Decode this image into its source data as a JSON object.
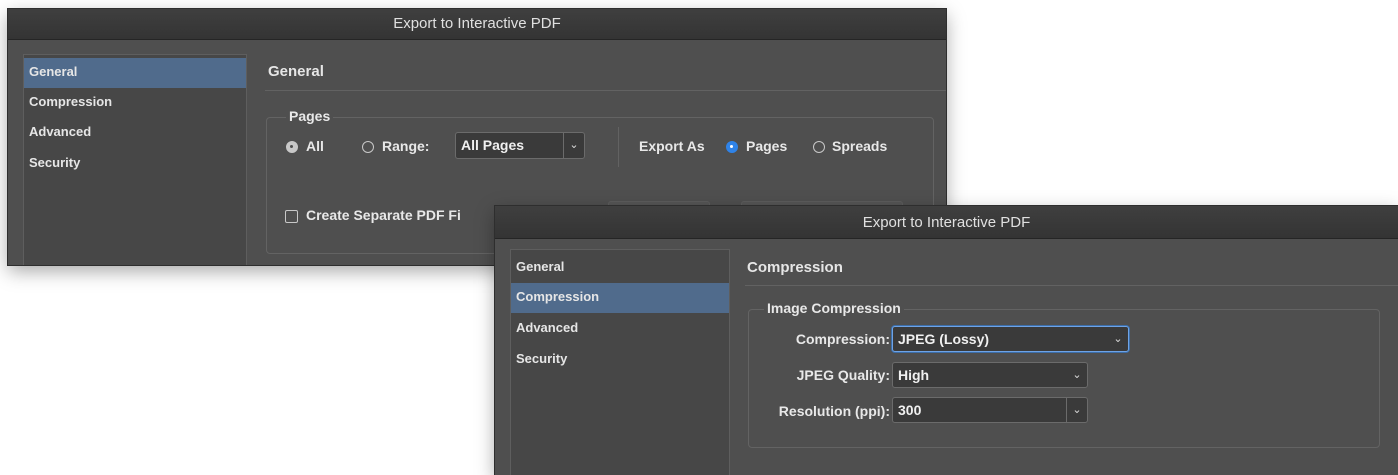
{
  "back_dialog": {
    "title": "Export to Interactive PDF",
    "sidebar": [
      {
        "label": "General",
        "selected": true
      },
      {
        "label": "Compression",
        "selected": false
      },
      {
        "label": "Advanced",
        "selected": false
      },
      {
        "label": "Security",
        "selected": false
      }
    ],
    "section_title": "General",
    "pages": {
      "group_title": "Pages",
      "all_label": "All",
      "all_selected": true,
      "range_label": "Range:",
      "range_value": "All Pages",
      "export_as_label": "Export As",
      "pages_label": "Pages",
      "pages_selected": true,
      "spreads_label": "Spreads",
      "create_separate_label": "Create Separate PDF Fi",
      "create_separate_checked": false
    }
  },
  "front_dialog": {
    "title": "Export to Interactive PDF",
    "sidebar": [
      {
        "label": "General",
        "selected": false
      },
      {
        "label": "Compression",
        "selected": true
      },
      {
        "label": "Advanced",
        "selected": false
      },
      {
        "label": "Security",
        "selected": false
      }
    ],
    "section_title": "Compression",
    "image_compression": {
      "group_title": "Image Compression",
      "compression_label": "Compression:",
      "compression_value": "JPEG (Lossy)",
      "quality_label": "JPEG Quality:",
      "quality_value": "High",
      "resolution_label": "Resolution (ppi):",
      "resolution_value": "300"
    }
  },
  "colors": {
    "selection": "#506b8c",
    "radio_accent": "#2f83e8",
    "focus_ring": "#6ea3e6"
  }
}
